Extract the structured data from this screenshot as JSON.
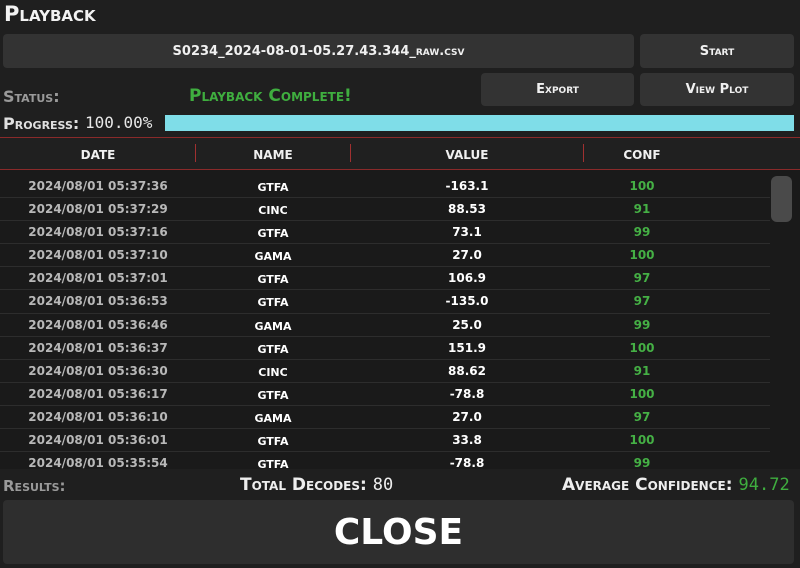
{
  "window": {
    "title": "Playback"
  },
  "toolbar": {
    "file_label": "S0234_2024-08-01-05.27.43.344_raw.csv",
    "start_label": "Start",
    "export_label": "Export",
    "view_plot_label": "View Plot"
  },
  "status": {
    "label": "Status:",
    "value": "Playback Complete!",
    "value_color": "#3fae3f"
  },
  "progress": {
    "label": "Progress:",
    "text": "100.00%",
    "value": 1.0,
    "color": "#7fdde8"
  },
  "table": {
    "columns": [
      "DATE",
      "NAME",
      "VALUE",
      "CONF"
    ],
    "rows": [
      {
        "date": "2024/08/01 05:37:36",
        "name": "GTFA",
        "value": "-163.1",
        "conf": "100"
      },
      {
        "date": "2024/08/01 05:37:29",
        "name": "CINC",
        "value": "88.53",
        "conf": "91"
      },
      {
        "date": "2024/08/01 05:37:16",
        "name": "GTFA",
        "value": "73.1",
        "conf": "99"
      },
      {
        "date": "2024/08/01 05:37:10",
        "name": "GAMA",
        "value": "27.0",
        "conf": "100"
      },
      {
        "date": "2024/08/01 05:37:01",
        "name": "GTFA",
        "value": "106.9",
        "conf": "97"
      },
      {
        "date": "2024/08/01 05:36:53",
        "name": "GTFA",
        "value": "-135.0",
        "conf": "97"
      },
      {
        "date": "2024/08/01 05:36:46",
        "name": "GAMA",
        "value": "25.0",
        "conf": "99"
      },
      {
        "date": "2024/08/01 05:36:37",
        "name": "GTFA",
        "value": "151.9",
        "conf": "100"
      },
      {
        "date": "2024/08/01 05:36:30",
        "name": "CINC",
        "value": "88.62",
        "conf": "91"
      },
      {
        "date": "2024/08/01 05:36:17",
        "name": "GTFA",
        "value": "-78.8",
        "conf": "100"
      },
      {
        "date": "2024/08/01 05:36:10",
        "name": "GAMA",
        "value": "27.0",
        "conf": "97"
      },
      {
        "date": "2024/08/01 05:36:01",
        "name": "GTFA",
        "value": "33.8",
        "conf": "100"
      },
      {
        "date": "2024/08/01 05:35:54",
        "name": "GTFA",
        "value": "-78.8",
        "conf": "99"
      }
    ]
  },
  "results": {
    "label": "Results:",
    "total_decodes_label": "Total Decodes:",
    "total_decodes": "80",
    "avg_confidence_label": "Average Confidence:",
    "avg_confidence": "94.72"
  },
  "close_label": "CLOSE"
}
